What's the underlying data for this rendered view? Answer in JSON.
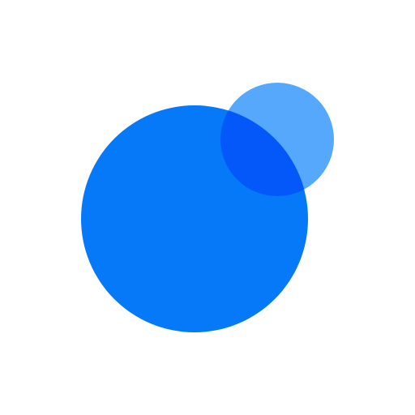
{
  "icon": {
    "name": "two-overlapping-circles-logo",
    "colors": {
      "background": "#FFFFFF",
      "large_circle": "#0579F8",
      "small_circle": "#55A8FC",
      "overlap": "#0458FA"
    }
  }
}
